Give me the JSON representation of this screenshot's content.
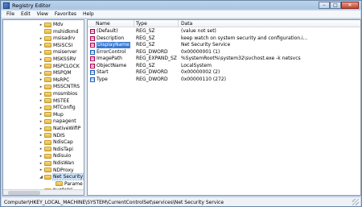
{
  "window": {
    "title": "Registry Editor",
    "minimize_glyph": "–",
    "maximize_glyph": "□",
    "close_glyph": "✕"
  },
  "menu": [
    "File",
    "Edit",
    "View",
    "Favorites",
    "Help"
  ],
  "tree": {
    "items": [
      {
        "label": "Mdv",
        "expander": "▸"
      },
      {
        "label": "mshidkmd",
        "expander": ""
      },
      {
        "label": "msisadrv",
        "expander": "▸"
      },
      {
        "label": "MSiSCSI",
        "expander": "▸"
      },
      {
        "label": "msiserver",
        "expander": "▸"
      },
      {
        "label": "MSKSSRV",
        "expander": "▸"
      },
      {
        "label": "MSPCLOCK",
        "expander": "▸"
      },
      {
        "label": "MSPQM",
        "expander": "▸"
      },
      {
        "label": "MsRPC",
        "expander": "▸"
      },
      {
        "label": "MSSCNTRS",
        "expander": "▸"
      },
      {
        "label": "mssmbios",
        "expander": "▸"
      },
      {
        "label": "MSTEE",
        "expander": "▸"
      },
      {
        "label": "MTConfig",
        "expander": "▸"
      },
      {
        "label": "Mup",
        "expander": "▸"
      },
      {
        "label": "napagent",
        "expander": "▸"
      },
      {
        "label": "NativeWifiP",
        "expander": "▸"
      },
      {
        "label": "NDIS",
        "expander": "▸"
      },
      {
        "label": "NdisCap",
        "expander": "▸"
      },
      {
        "label": "NdisTapi",
        "expander": "▸"
      },
      {
        "label": "Ndisuio",
        "expander": "▸"
      },
      {
        "label": "NdisWan",
        "expander": "▸"
      },
      {
        "label": "NDProxy",
        "expander": "▸"
      },
      {
        "label": "Net Security",
        "expander": "◢"
      },
      {
        "label": "Parame",
        "expander": ""
      },
      {
        "label": "NetBIOS",
        "expander": "▸"
      }
    ]
  },
  "values": {
    "columns": [
      "Name",
      "Type",
      "Data"
    ],
    "rows": [
      {
        "icon": "ab",
        "name": "(Default)",
        "type": "REG_SZ",
        "data": "(value not set)"
      },
      {
        "icon": "ab",
        "name": "Description",
        "type": "REG_SZ",
        "data": "keep watch on system security and configuration.i..."
      },
      {
        "icon": "ab",
        "name": "DisplayName",
        "type": "REG_SZ",
        "data": "Net Security Service"
      },
      {
        "icon": "01",
        "name": "ErrorControl",
        "type": "REG_DWORD",
        "data": "0x00000001 (1)"
      },
      {
        "icon": "ab",
        "name": "ImagePath",
        "type": "REG_EXPAND_SZ",
        "data": "%SystemRoot%\\system32\\svchost.exe -k netsvcs"
      },
      {
        "icon": "ab",
        "name": "ObjectName",
        "type": "REG_SZ",
        "data": "LocalSystem"
      },
      {
        "icon": "01",
        "name": "Start",
        "type": "REG_DWORD",
        "data": "0x00000002 (2)"
      },
      {
        "icon": "01",
        "name": "Type",
        "type": "REG_DWORD",
        "data": "0x00000110 (272)"
      }
    ]
  },
  "status": {
    "path": "Computer\\HKEY_LOCAL_MACHINE\\SYSTEM\\CurrentControlSet\\services\\Net Security Service"
  }
}
